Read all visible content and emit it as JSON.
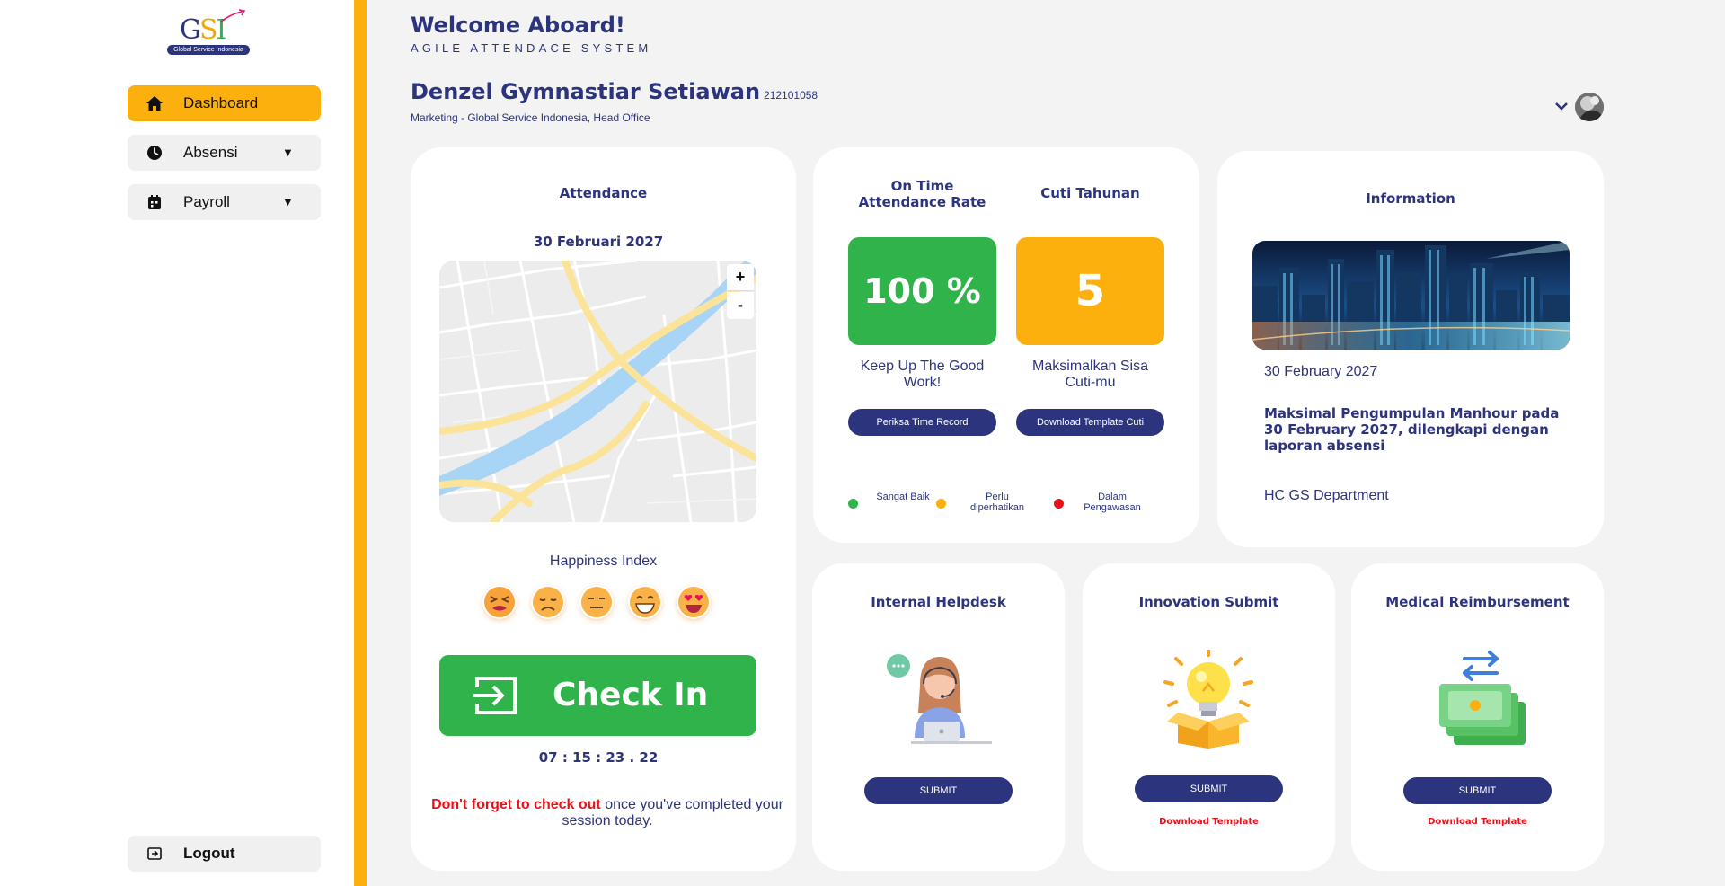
{
  "logo": {
    "text_g": "G",
    "text_s": "S",
    "text_i": "I",
    "subtitle": "Global Service Indonesia"
  },
  "sidebar": {
    "items": [
      {
        "label": "Dashboard",
        "icon": "home-icon",
        "caret": ""
      },
      {
        "label": "Absensi",
        "icon": "clock-icon",
        "caret": "▼"
      },
      {
        "label": "Payroll",
        "icon": "calendar-icon",
        "caret": "▼"
      }
    ],
    "logout_label": "Logout"
  },
  "header": {
    "welcome": "Welcome Aboard!",
    "system": "AGILE ATTENDACE SYSTEM",
    "user_name": "Denzel Gymnastiar Setiawan",
    "user_id": "212101058",
    "user_dept": "Marketing - Global Service Indonesia, Head Office"
  },
  "attendance": {
    "title": "Attendance",
    "date": "30 Februari 2027",
    "zoom_in": "+",
    "zoom_out": "-",
    "happiness_title": "Happiness Index",
    "emojis": [
      "tired-face-icon",
      "disappointed-face-icon",
      "expressionless-face-icon",
      "grinning-face-icon",
      "heart-eyes-face-icon"
    ],
    "checkin_label": "Check In",
    "clock": "07 : 15 : 23 . 22",
    "reminder_red": "Don't forget to check out",
    "reminder_rest": " once you've completed your session today."
  },
  "stats": {
    "ontime_title": "On Time Attendance Rate",
    "ontime_value": "100 %",
    "ontime_sub": "Keep Up The Good Work!",
    "ontime_button": "Periksa Time Record",
    "cuti_title": "Cuti Tahunan",
    "cuti_value": "5",
    "cuti_sub": "Maksimalkan Sisa Cuti-mu",
    "cuti_button": "Download Template  Cuti",
    "legend": [
      {
        "label": "Sangat Baik",
        "color": "#2fb34a"
      },
      {
        "label": "Perlu diperhatikan",
        "color": "#fcb00d"
      },
      {
        "label": "Dalam Pengawasan",
        "color": "#e8121b"
      }
    ]
  },
  "information": {
    "title": "Information",
    "date": "30 February 2027",
    "text": "Maksimal Pengumpulan Manhour pada 30 February 2027, dilengkapi dengan laporan absensi",
    "dept": "HC GS Department"
  },
  "helpdesk": {
    "title": "Internal Helpdesk",
    "button": "SUBMIT"
  },
  "innovation": {
    "title": "Innovation Submit",
    "button": "SUBMIT",
    "download": "Download Template"
  },
  "medical": {
    "title": "Medical Reimbursement",
    "button": "SUBMIT",
    "download": "Download Template"
  },
  "colors": {
    "primary": "#2b347c",
    "accent": "#fcb00d",
    "success": "#2fb34a",
    "danger": "#e8121b"
  }
}
